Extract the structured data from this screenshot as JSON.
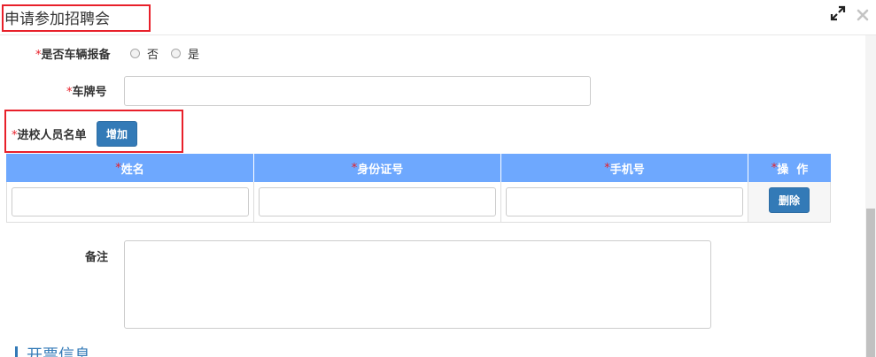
{
  "dialog": {
    "title": "申请参加招聘会"
  },
  "form": {
    "vehicle_question": {
      "required": "*",
      "label": "是否车辆报备",
      "options": [
        "否",
        "是"
      ]
    },
    "plate": {
      "required": "*",
      "label": "车牌号",
      "value": ""
    },
    "visitors": {
      "required": "*",
      "label": "进校人员名单",
      "add_button": "增加"
    },
    "grid": {
      "columns": [
        {
          "required": "*",
          "label": "姓名"
        },
        {
          "required": "*",
          "label": "身份证号"
        },
        {
          "required": "*",
          "label": "手机号"
        },
        {
          "required": "*",
          "label": "操  作"
        }
      ],
      "rows": [
        {
          "name": "",
          "id_number": "",
          "phone": "",
          "delete_button": "删除"
        }
      ]
    },
    "remarks": {
      "label": "备注",
      "value": ""
    }
  },
  "sections": {
    "invoice_title": "开票信息"
  },
  "colors": {
    "accent": "#337ab7",
    "grid_header": "#6ea8fe",
    "required": "#e8202a",
    "highlight": "#e8202a"
  },
  "icons": [
    "expand-icon",
    "close-icon"
  ]
}
